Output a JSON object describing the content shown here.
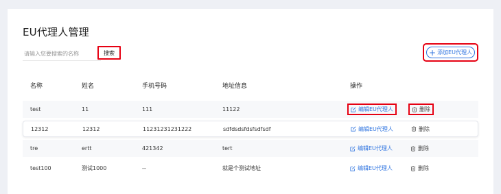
{
  "page": {
    "title": "EU代理人管理"
  },
  "search": {
    "placeholder": "请输入您要搜索的名称",
    "button_label": "搜索"
  },
  "toolbar": {
    "add_label": "添加EU代理人"
  },
  "table": {
    "columns": [
      "名称",
      "姓名",
      "手机号码",
      "地址信息",
      "操作"
    ],
    "rows": [
      {
        "name": "test",
        "person": "11",
        "phone": "111",
        "address": "11122"
      },
      {
        "name": "12312",
        "person": "12312",
        "phone": "11231231231222",
        "address": "sdfdsdsfdsfsdfsdf"
      },
      {
        "name": "tre",
        "person": "ertt",
        "phone": "421342",
        "address": "tert"
      },
      {
        "name": "test100",
        "person": "测试1000",
        "phone": "--",
        "address": "就是个测试地址"
      }
    ],
    "actions": {
      "edit_label": "编辑EU代理人",
      "delete_label": "删除"
    }
  },
  "colors": {
    "accent": "#2f74e0",
    "highlight": "#e60012",
    "background": "#eef0f5"
  },
  "icons": {
    "add": "plus-icon",
    "edit": "edit-icon",
    "delete": "trash-icon"
  }
}
